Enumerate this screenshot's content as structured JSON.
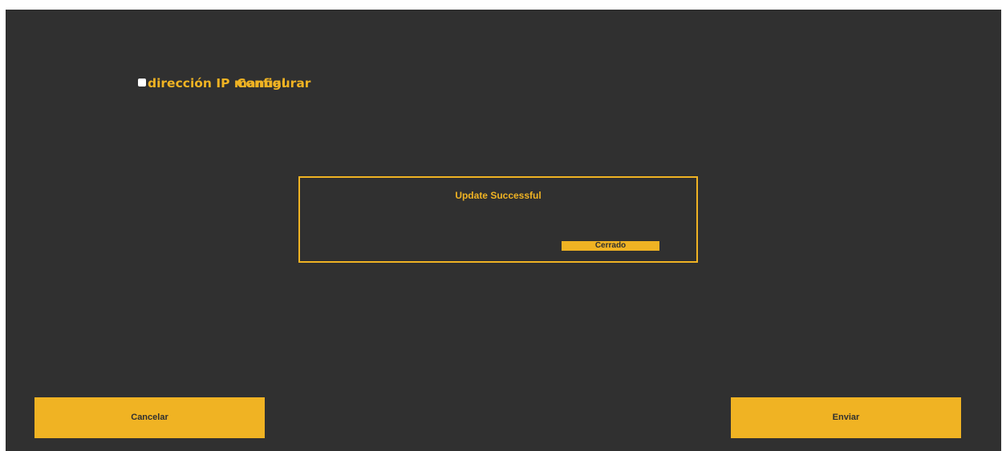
{
  "settings": {
    "manual_ip_label": "dirección IP manual",
    "manual_ip_checked": false,
    "configure_label": "Configurar"
  },
  "dialog": {
    "message": "Update Successful",
    "close_label": "Cerrado"
  },
  "footer": {
    "cancel_label": "Cancelar",
    "submit_label": "Enviar"
  },
  "colors": {
    "background": "#303030",
    "accent": "#f0b323"
  }
}
